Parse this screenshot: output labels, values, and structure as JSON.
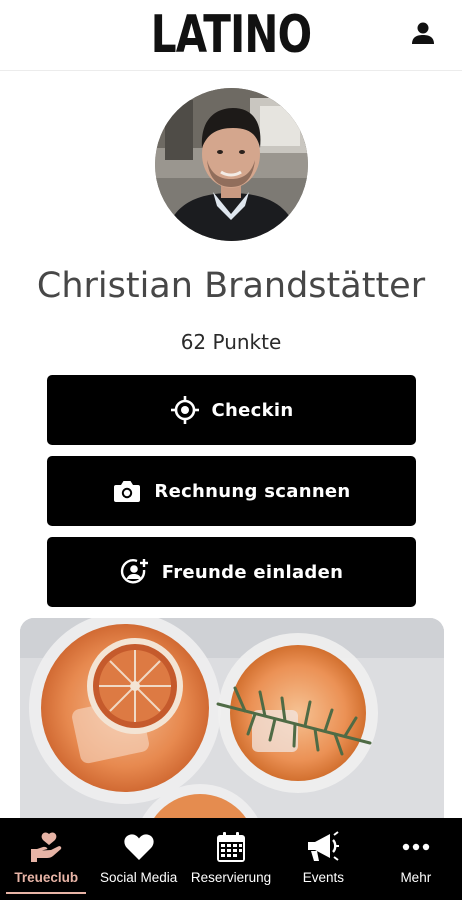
{
  "header": {
    "logo_text": "LATINO",
    "user_icon": "user-icon"
  },
  "profile": {
    "name": "Christian Brandstätter",
    "points": "62 Punkte",
    "avatar_icon": "profile-photo"
  },
  "actions": [
    {
      "label": "Checkin",
      "icon": "crosshair-icon"
    },
    {
      "label": "Rechnung scannen",
      "icon": "camera-icon"
    },
    {
      "label": "Freunde einladen",
      "icon": "add-friend-icon"
    }
  ],
  "bottom_nav": {
    "active_index": 0,
    "items": [
      {
        "label": "Treueclub",
        "icon": "hand-heart-icon"
      },
      {
        "label": "Social Media",
        "icon": "heart-icon"
      },
      {
        "label": "Reservierung",
        "icon": "calendar-icon"
      },
      {
        "label": "Events",
        "icon": "megaphone-icon"
      },
      {
        "label": "Mehr",
        "icon": "more-icon"
      }
    ]
  },
  "colors": {
    "button_bg": "#000000",
    "nav_bg": "#000000",
    "nav_active": "#e7b4a6",
    "name_text": "#474747"
  }
}
